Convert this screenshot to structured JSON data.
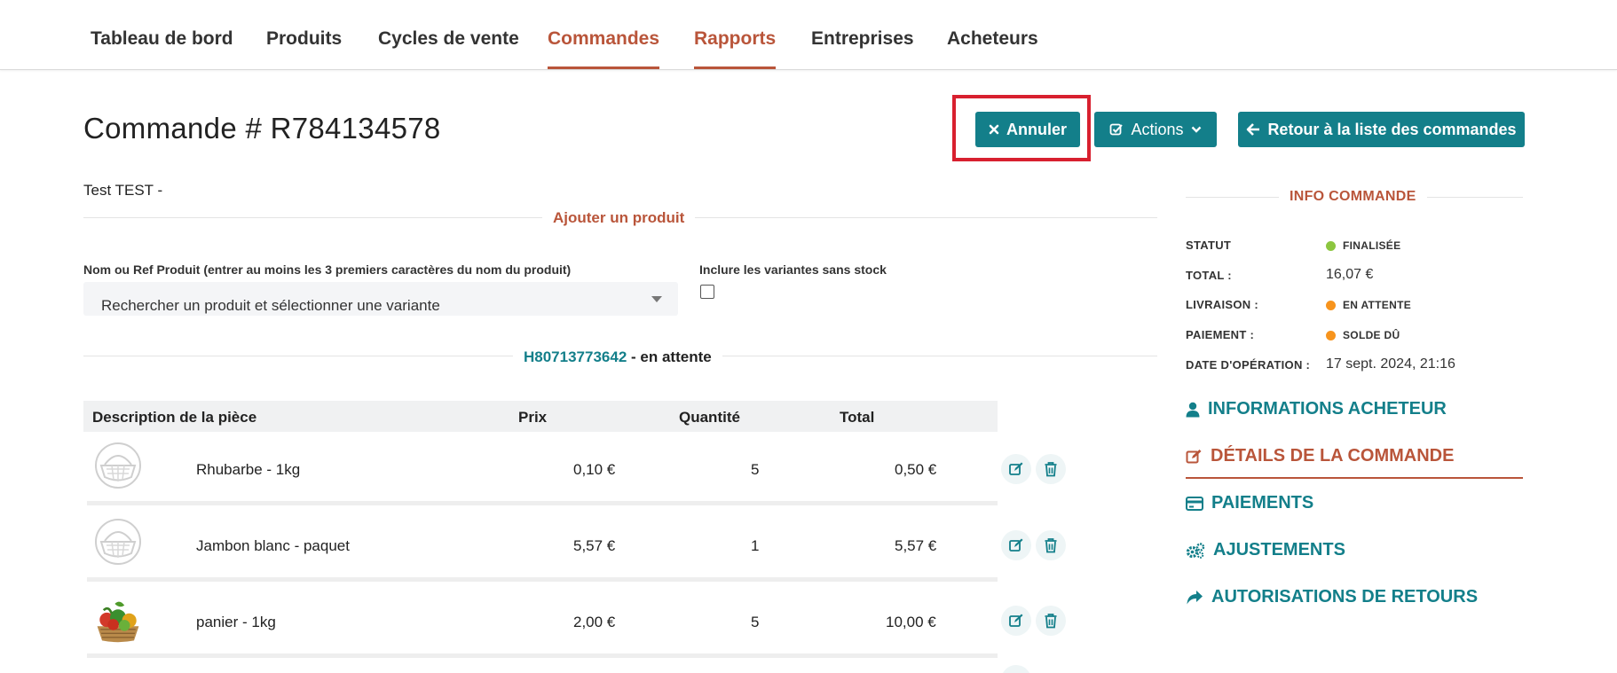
{
  "nav": {
    "items": [
      {
        "label": "Tableau de bord",
        "active": false
      },
      {
        "label": "Produits",
        "active": false
      },
      {
        "label": "Cycles de vente",
        "active": false
      },
      {
        "label": "Commandes",
        "active": true
      },
      {
        "label": "Rapports",
        "active": true
      },
      {
        "label": "Entreprises",
        "active": false
      },
      {
        "label": "Acheteurs",
        "active": false
      }
    ]
  },
  "header": {
    "title": "Commande # R784134578",
    "cancel_label": "Annuler",
    "actions_label": "Actions",
    "back_label": "Retour à la liste des commandes"
  },
  "customer": "Test TEST -",
  "add_product": {
    "section_title": "Ajouter un produit",
    "product_field_label": "Nom ou Ref Produit (entrer au moins les 3 premiers caractères du nom du produit)",
    "product_placeholder": "Rechercher un produit et sélectionner une variante",
    "variants_label": "Inclure les variantes sans stock",
    "variants_checked": false
  },
  "shipment": {
    "number": "H80713773642",
    "state": "- en attente"
  },
  "table": {
    "headers": [
      "Description de la pièce",
      "Prix",
      "Quantité",
      "Total"
    ],
    "rows": [
      {
        "image": "basket-placeholder",
        "name": "Rhubarbe - 1kg",
        "price": "0,10 €",
        "quantity": "5",
        "total": "0,50 €"
      },
      {
        "image": "basket-placeholder",
        "name": "Jambon blanc - paquet",
        "price": "5,57 €",
        "quantity": "1",
        "total": "5,57 €"
      },
      {
        "image": "vegetable-basket-photo",
        "name": "panier - 1kg",
        "price": "2,00 €",
        "quantity": "5",
        "total": "10,00 €"
      }
    ]
  },
  "order_info": {
    "title": "INFO COMMANDE",
    "status_label": "STATUT",
    "status_value": "FINALISÉE",
    "total_label": "TOTAL :",
    "total_value": "16,07 €",
    "shipping_label": "LIVRAISON :",
    "shipping_value": "EN ATTENTE",
    "payment_label": "PAIEMENT :",
    "payment_value": "SOLDE DÛ",
    "date_label": "DATE D'OPÉRATION :",
    "date_value": "17 sept. 2024, 21:16"
  },
  "side_nav": {
    "buyer_info": "INFORMATIONS ACHETEUR",
    "order_details": "DÉTAILS DE LA COMMANDE",
    "payments": "PAIEMENTS",
    "adjustments": "AJUSTEMENTS",
    "returns": "AUTORISATIONS DE RETOURS"
  },
  "colors": {
    "teal": "#137f8a",
    "accent": "#b9553a",
    "status_green": "#8cc63f",
    "status_orange": "#f7941d",
    "highlight_red": "#d8202f"
  }
}
